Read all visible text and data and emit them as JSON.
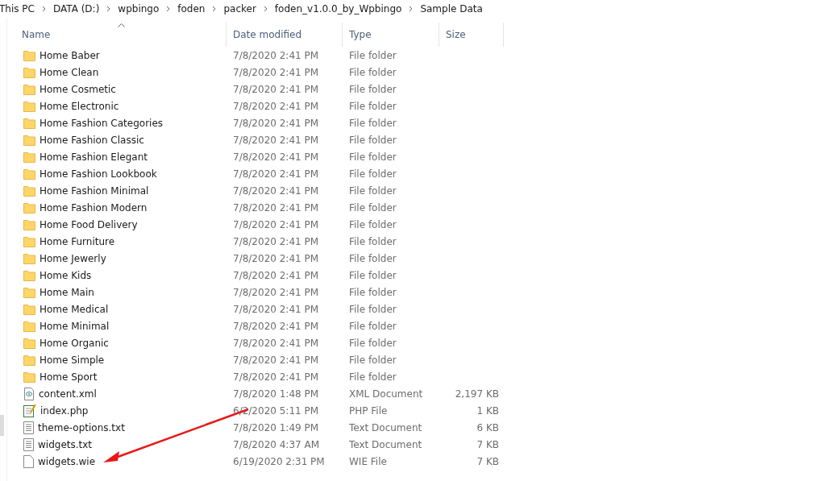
{
  "breadcrumb": [
    "This PC",
    "DATA (D:)",
    "wpbingo",
    "foden",
    "packer",
    "foden_v1.0.0_by_Wpbingo",
    "Sample Data"
  ],
  "columns": [
    {
      "label": "Name",
      "sorted": true
    },
    {
      "label": "Date modified",
      "sorted": false
    },
    {
      "label": "Type",
      "sorted": false
    },
    {
      "label": "Size",
      "sorted": false
    }
  ],
  "rows": [
    {
      "kind": "folder",
      "name": "Home Baber",
      "date": "7/8/2020 2:41 PM",
      "type": "File folder"
    },
    {
      "kind": "folder",
      "name": "Home Clean",
      "date": "7/8/2020 2:41 PM",
      "type": "File folder"
    },
    {
      "kind": "folder",
      "name": "Home Cosmetic",
      "date": "7/8/2020 2:41 PM",
      "type": "File folder"
    },
    {
      "kind": "folder",
      "name": "Home Electronic",
      "date": "7/8/2020 2:41 PM",
      "type": "File folder"
    },
    {
      "kind": "folder",
      "name": "Home Fashion Categories",
      "date": "7/8/2020 2:41 PM",
      "type": "File folder"
    },
    {
      "kind": "folder",
      "name": "Home Fashion Classic",
      "date": "7/8/2020 2:41 PM",
      "type": "File folder"
    },
    {
      "kind": "folder",
      "name": "Home Fashion Elegant",
      "date": "7/8/2020 2:41 PM",
      "type": "File folder"
    },
    {
      "kind": "folder",
      "name": "Home Fashion Lookbook",
      "date": "7/8/2020 2:41 PM",
      "type": "File folder"
    },
    {
      "kind": "folder",
      "name": "Home Fashion Minimal",
      "date": "7/8/2020 2:41 PM",
      "type": "File folder"
    },
    {
      "kind": "folder",
      "name": "Home Fashion Modern",
      "date": "7/8/2020 2:41 PM",
      "type": "File folder"
    },
    {
      "kind": "folder",
      "name": "Home Food Delivery",
      "date": "7/8/2020 2:41 PM",
      "type": "File folder"
    },
    {
      "kind": "folder",
      "name": "Home Furniture",
      "date": "7/8/2020 2:41 PM",
      "type": "File folder"
    },
    {
      "kind": "folder",
      "name": "Home Jewerly",
      "date": "7/8/2020 2:41 PM",
      "type": "File folder"
    },
    {
      "kind": "folder",
      "name": "Home Kids",
      "date": "7/8/2020 2:41 PM",
      "type": "File folder"
    },
    {
      "kind": "folder",
      "name": "Home Main",
      "date": "7/8/2020 2:41 PM",
      "type": "File folder"
    },
    {
      "kind": "folder",
      "name": "Home Medical",
      "date": "7/8/2020 2:41 PM",
      "type": "File folder"
    },
    {
      "kind": "folder",
      "name": "Home Minimal",
      "date": "7/8/2020 2:41 PM",
      "type": "File folder"
    },
    {
      "kind": "folder",
      "name": "Home Organic",
      "date": "7/8/2020 2:41 PM",
      "type": "File folder"
    },
    {
      "kind": "folder",
      "name": "Home Simple",
      "date": "7/8/2020 2:41 PM",
      "type": "File folder"
    },
    {
      "kind": "folder",
      "name": "Home Sport",
      "date": "7/8/2020 2:41 PM",
      "type": "File folder"
    },
    {
      "kind": "xml",
      "name": "content.xml",
      "date": "7/8/2020 1:48 PM",
      "type": "XML Document",
      "size": "2,197 KB"
    },
    {
      "kind": "php",
      "name": "index.php",
      "date": "6/2/2020 5:11 PM",
      "type": "PHP File",
      "size": "1 KB"
    },
    {
      "kind": "text",
      "name": "theme-options.txt",
      "date": "7/8/2020 1:49 PM",
      "type": "Text Document",
      "size": "6 KB"
    },
    {
      "kind": "text",
      "name": "widgets.txt",
      "date": "7/8/2020 4:37 AM",
      "type": "Text Document",
      "size": "7 KB"
    },
    {
      "kind": "blank",
      "name": "widgets.wie",
      "date": "6/19/2020 2:31 PM",
      "type": "WIE File",
      "size": "7 KB"
    }
  ]
}
